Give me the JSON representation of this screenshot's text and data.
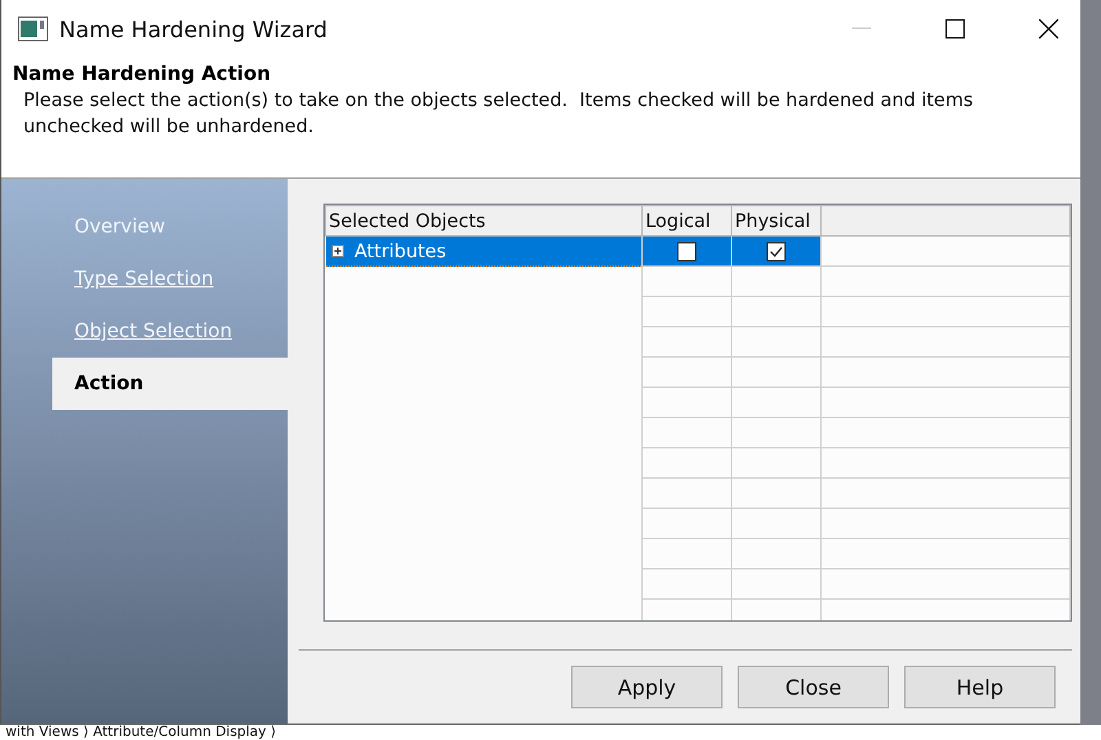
{
  "window": {
    "title": "Name Hardening Wizard"
  },
  "header": {
    "title": "Name Hardening Action",
    "description": "Please select the action(s) to take on the objects selected.  Items checked will be hardened and items unchecked will be unhardened."
  },
  "steps": [
    {
      "label": "Overview",
      "selected": false,
      "link": false
    },
    {
      "label": "Type Selection",
      "selected": false,
      "link": true
    },
    {
      "label": "Object Selection",
      "selected": false,
      "link": true
    },
    {
      "label": "Action",
      "selected": true,
      "link": false
    }
  ],
  "table": {
    "columns": [
      "Selected Objects",
      "Logical",
      "Physical"
    ],
    "rows": [
      {
        "name": "Attributes",
        "expanded": false,
        "selected": true,
        "logical": false,
        "physical": true
      }
    ]
  },
  "buttons": [
    "Apply",
    "Close",
    "Help"
  ],
  "background_text": "with Views ⟩ Attribute/Column Display ⟩"
}
